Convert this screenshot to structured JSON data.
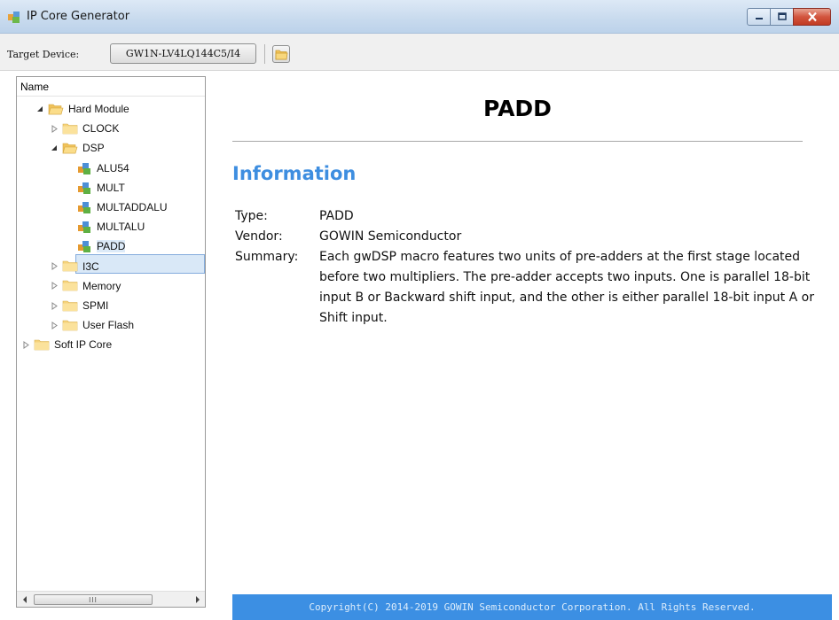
{
  "window": {
    "title": "IP Core Generator"
  },
  "toolbar": {
    "target_label": "Target Device:",
    "device_value": "GW1N-LV4LQ144C5/I4"
  },
  "tree": {
    "header": "Name",
    "nodes": [
      {
        "label": "Hard Module",
        "state": "expanded",
        "icon": "folder-open-icon"
      },
      {
        "label": "CLOCK",
        "state": "collapsed",
        "icon": "folder-icon"
      },
      {
        "label": "DSP",
        "state": "expanded",
        "icon": "folder-open-icon"
      },
      {
        "label": "ALU54",
        "state": "leaf",
        "icon": "ip-module-icon"
      },
      {
        "label": "MULT",
        "state": "leaf",
        "icon": "ip-module-icon"
      },
      {
        "label": "MULTADDALU",
        "state": "leaf",
        "icon": "ip-module-icon"
      },
      {
        "label": "MULTALU",
        "state": "leaf",
        "icon": "ip-module-icon"
      },
      {
        "label": "PADD",
        "state": "leaf-selected",
        "icon": "ip-module-icon"
      },
      {
        "label": "I3C",
        "state": "collapsed",
        "icon": "folder-icon"
      },
      {
        "label": "Memory",
        "state": "collapsed",
        "icon": "folder-icon"
      },
      {
        "label": "SPMI",
        "state": "collapsed",
        "icon": "folder-icon"
      },
      {
        "label": "User Flash",
        "state": "collapsed",
        "icon": "folder-icon"
      },
      {
        "label": "Soft IP Core",
        "state": "collapsed",
        "icon": "folder-icon"
      }
    ],
    "scroll_thumb_glyph": "III"
  },
  "content": {
    "title": "PADD",
    "section_title": "Information",
    "info": [
      {
        "key": "Type:",
        "value": "PADD"
      },
      {
        "key": "Vendor:",
        "value": "GOWIN Semiconductor"
      },
      {
        "key": "Summary:",
        "value": "Each gwDSP macro features two units of pre-adders at the first stage located before two multipliers. The pre-adder accepts two inputs. One is parallel 18-bit input B or Backward shift input, and the other is either parallel 18-bit input A or Shift input."
      }
    ],
    "footer": "Copyright(C) 2014-2019 GOWIN Semiconductor Corporation. All Rights Reserved."
  },
  "colors": {
    "accent": "#3e8ee0",
    "footer_bg": "#3c8fe3",
    "selection": "#d9e8f7"
  }
}
